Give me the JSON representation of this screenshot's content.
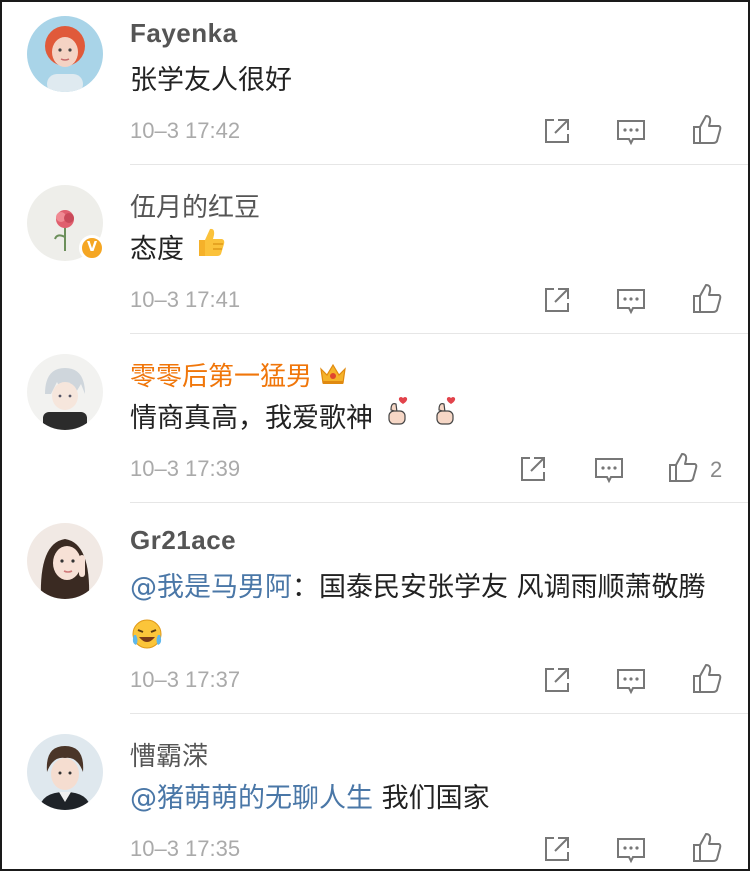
{
  "comments": [
    {
      "username": "Fayenka",
      "text": "张学友人很好",
      "time": "10–3 17:42",
      "avatar": "girl-red-hair-avatar"
    },
    {
      "username": "伍月的红豆",
      "text": "态度",
      "emoji": "thumbs-up-emoji",
      "time": "10–3 17:41",
      "avatar": "rose-avatar",
      "verified": "V"
    },
    {
      "username": "零零后第一猛男",
      "text": "情商真高，我爱歌神",
      "emoji": "finger-heart-emoji",
      "time": "10–3 17:39",
      "like_count": "2",
      "avatar": "anime-boy-avatar",
      "vip_icon": "crown-icon"
    },
    {
      "username": "Gr21ace",
      "mention": "@我是马男阿",
      "text": "：国泰民安张学友 风调雨顺萧敬腾",
      "emoji": "laugh-cry-emoji",
      "time": "10–3 17:37",
      "avatar": "girl-portrait-avatar"
    },
    {
      "username": "慒霸溁",
      "mention": "@猪萌萌的无聊人生",
      "text": " 我们国家",
      "time": "10–3 17:35",
      "avatar": "boy-portrait-avatar"
    }
  ],
  "icons": {
    "share": "share-icon",
    "comment": "comment-icon",
    "like": "like-icon"
  },
  "colors": {
    "mention": "#4a77a7",
    "vip_name": "#f0760a",
    "time": "#aaaaaa",
    "divider": "#e6e6e6"
  }
}
